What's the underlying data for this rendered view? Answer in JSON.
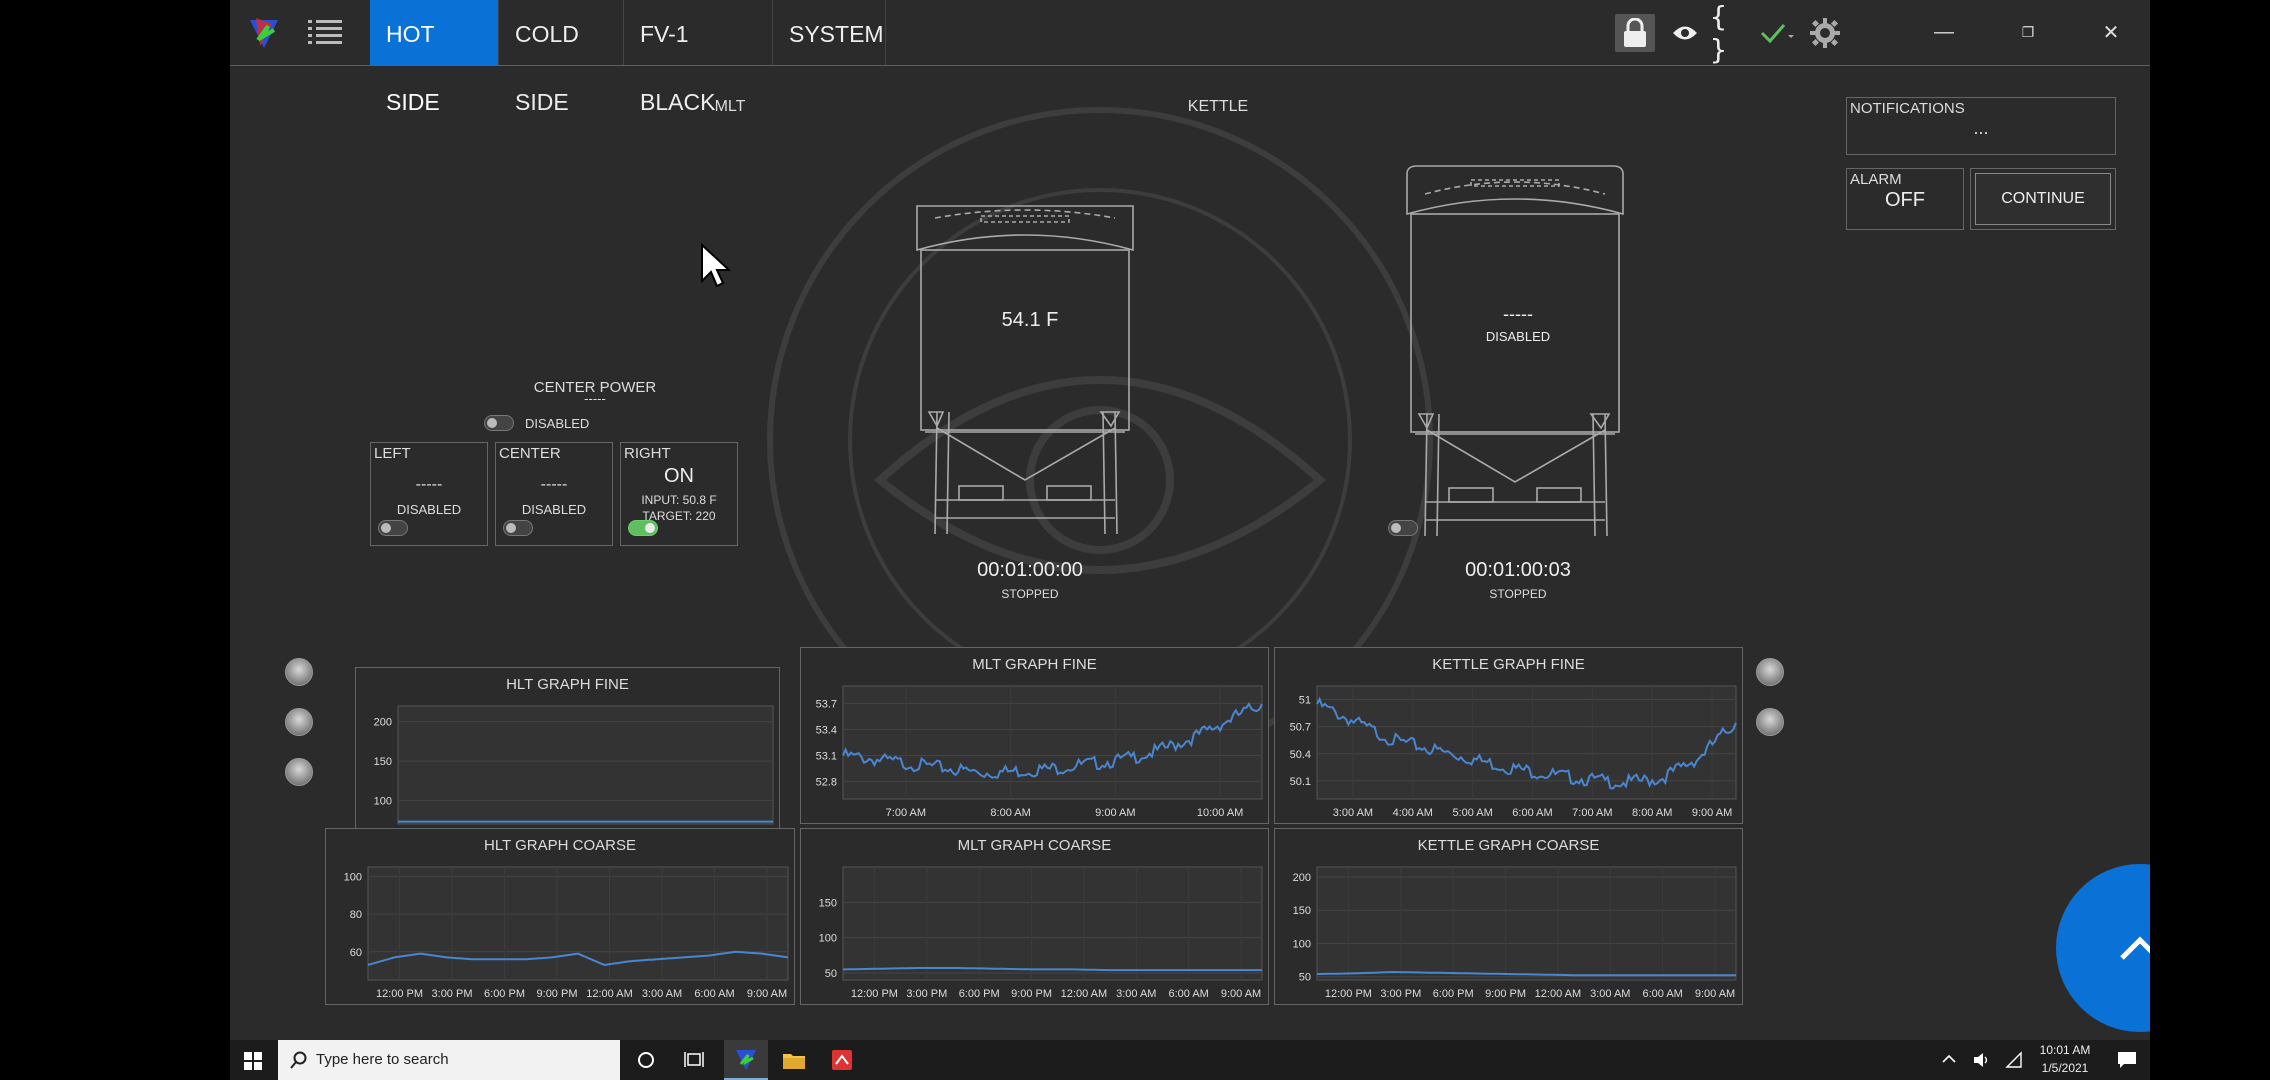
{
  "tabs": [
    {
      "label": "HOT SIDE",
      "active": true
    },
    {
      "label": "COLD SIDE",
      "active": false
    },
    {
      "label": "FV-1 BLACK",
      "active": false
    },
    {
      "label": "SYSTEM",
      "active": false
    }
  ],
  "toolbar": {
    "braces_label": "{ }",
    "icons": [
      "lock-icon",
      "eye-icon",
      "braces-icon",
      "checkmark-icon",
      "gear-icon"
    ],
    "accent_color": "#0a72d6"
  },
  "window_controls": {
    "minimize": "—",
    "maximize": "❐",
    "close": "✕"
  },
  "mlt": {
    "title": "MLT",
    "reading": "54.1 F",
    "timer": "00:01:00:00",
    "timer_status": "STOPPED"
  },
  "kettle": {
    "title": "KETTLE",
    "reading": "-----",
    "status": "DISABLED",
    "timer": "00:01:00:03",
    "timer_status": "STOPPED"
  },
  "notifications": {
    "label": "NOTIFICATIONS",
    "value": "...",
    "alarm_label": "ALARM",
    "alarm_value": "OFF",
    "continue_label": "CONTINUE"
  },
  "hlt": {
    "center_power_label": "CENTER POWER",
    "center_power_value": "-----",
    "center_power_status": "DISABLED",
    "left": {
      "title": "LEFT",
      "value": "-----",
      "status": "DISABLED"
    },
    "center": {
      "title": "CENTER",
      "value": "-----",
      "status": "DISABLED"
    },
    "right": {
      "title": "RIGHT",
      "value": "ON",
      "input": "INPUT: 50.8 F",
      "target": "TARGET: 220"
    }
  },
  "chart_data": [
    {
      "id": "hlt-fine",
      "type": "line",
      "title": "HLT GRAPH FINE",
      "ylim": [
        70,
        220
      ],
      "yticks": [
        200,
        150,
        100
      ],
      "xticks": [],
      "series": [
        {
          "values": [
            73,
            73,
            73,
            73,
            73,
            73
          ]
        }
      ]
    },
    {
      "id": "mlt-fine",
      "type": "line",
      "title": "MLT GRAPH FINE",
      "ylim": [
        52.6,
        53.9
      ],
      "yticks": [
        53.7,
        53.4,
        53.1,
        52.8
      ],
      "xticks": [
        "7:00 AM",
        "8:00 AM",
        "9:00 AM",
        "10:00 AM"
      ],
      "series": [
        {
          "values": [
            53.1,
            53.05,
            53.0,
            52.95,
            52.9,
            52.92,
            52.95,
            53.0,
            53.05,
            53.15,
            53.3,
            53.5,
            53.7
          ]
        }
      ]
    },
    {
      "id": "kettle-fine",
      "type": "line",
      "title": "KETTLE GRAPH FINE",
      "ylim": [
        49.9,
        51.15
      ],
      "yticks": [
        51,
        50.7,
        50.4,
        50.1
      ],
      "xticks": [
        "3:00 AM",
        "4:00 AM",
        "5:00 AM",
        "6:00 AM",
        "7:00 AM",
        "8:00 AM",
        "9:00 AM"
      ],
      "series": [
        {
          "values": [
            50.95,
            50.75,
            50.55,
            50.45,
            50.35,
            50.25,
            50.18,
            50.12,
            50.08,
            50.12,
            50.35,
            50.75
          ]
        }
      ]
    },
    {
      "id": "hlt-coarse",
      "type": "line",
      "title": "HLT GRAPH COARSE",
      "ylim": [
        45,
        105
      ],
      "yticks": [
        100,
        80,
        60
      ],
      "xticks": [
        "12:00 PM",
        "3:00 PM",
        "6:00 PM",
        "9:00 PM",
        "12:00 AM",
        "3:00 AM",
        "6:00 AM",
        "9:00 AM"
      ],
      "series": [
        {
          "values": [
            53,
            57,
            59,
            57,
            56,
            56,
            56,
            57,
            59,
            53,
            55,
            56,
            57,
            58,
            60,
            59,
            57
          ]
        }
      ]
    },
    {
      "id": "mlt-coarse",
      "type": "line",
      "title": "MLT GRAPH COARSE",
      "ylim": [
        40,
        200
      ],
      "yticks": [
        150,
        100,
        50
      ],
      "xticks": [
        "12:00 PM",
        "3:00 PM",
        "6:00 PM",
        "9:00 PM",
        "12:00 AM",
        "3:00 AM",
        "6:00 AM",
        "9:00 AM"
      ],
      "series": [
        {
          "values": [
            55,
            56,
            57,
            57,
            56,
            55,
            55,
            54,
            54,
            54,
            54,
            54
          ]
        }
      ]
    },
    {
      "id": "kettle-coarse",
      "type": "line",
      "title": "KETTLE GRAPH COARSE",
      "ylim": [
        45,
        215
      ],
      "yticks": [
        200,
        150,
        100,
        50
      ],
      "xticks": [
        "12:00 PM",
        "3:00 PM",
        "6:00 PM",
        "9:00 PM",
        "12:00 AM",
        "3:00 AM",
        "6:00 AM",
        "9:00 AM"
      ],
      "series": [
        {
          "values": [
            54,
            55,
            57,
            56,
            55,
            54,
            53,
            52,
            52,
            52,
            52,
            52
          ]
        }
      ]
    }
  ],
  "taskbar": {
    "search_placeholder": "Type here to search",
    "time": "10:01 AM",
    "date": "1/5/2021"
  }
}
